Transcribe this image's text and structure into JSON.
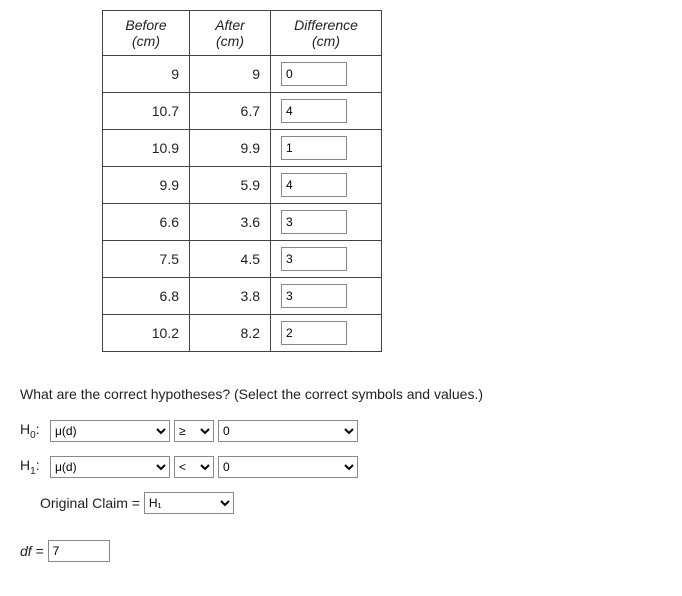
{
  "table": {
    "headers": {
      "before": "Before (cm)",
      "after": "After (cm)",
      "diff": "Difference (cm)"
    },
    "rows": [
      {
        "before": "9",
        "after": "9",
        "diff": "0"
      },
      {
        "before": "10.7",
        "after": "6.7",
        "diff": "4"
      },
      {
        "before": "10.9",
        "after": "9.9",
        "diff": "1"
      },
      {
        "before": "9.9",
        "after": "5.9",
        "diff": "4"
      },
      {
        "before": "6.6",
        "after": "3.6",
        "diff": "3"
      },
      {
        "before": "7.5",
        "after": "4.5",
        "diff": "3"
      },
      {
        "before": "6.8",
        "after": "3.8",
        "diff": "3"
      },
      {
        "before": "10.2",
        "after": "8.2",
        "diff": "2"
      }
    ]
  },
  "question": "What are the correct hypotheses? (Select the correct symbols and values.)",
  "h0": {
    "label_prefix": "H",
    "label_sub": "0",
    "label_suffix": ":",
    "param": "μ(d)",
    "op": "≥",
    "val": "0"
  },
  "h1": {
    "label_prefix": "H",
    "label_sub": "1",
    "label_suffix": ":",
    "param": "μ(d)",
    "op": "<",
    "val": "0"
  },
  "orig": {
    "label": "Original Claim = ",
    "value": "H₁"
  },
  "df": {
    "label_prefix": "df",
    "label_eq": " = ",
    "value": "7"
  }
}
